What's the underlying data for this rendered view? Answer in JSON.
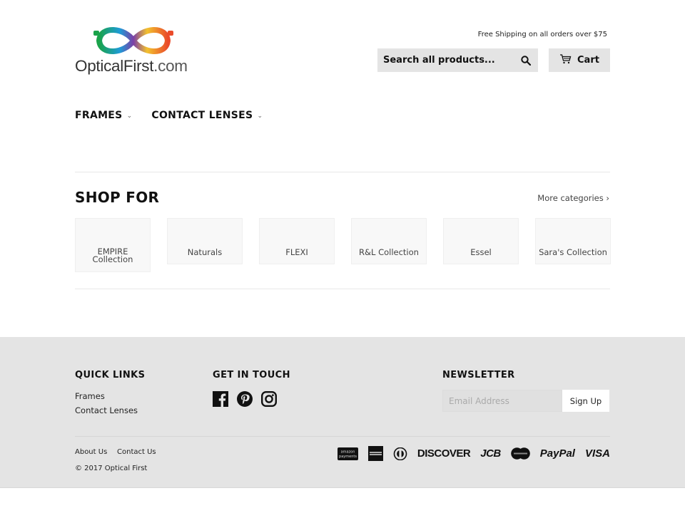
{
  "header": {
    "logo": {
      "name": "OpticalFirst",
      "suffix": ".com"
    },
    "promo": "Free Shipping on all orders over $75",
    "search": {
      "placeholder": "Search all products...",
      "value": ""
    },
    "cart_label": "Cart"
  },
  "nav": {
    "items": [
      {
        "label": "FRAMES",
        "icon": "chevron-down-icon"
      },
      {
        "label": "CONTACT LENSES",
        "icon": "chevron-down-icon"
      }
    ]
  },
  "shop": {
    "title": "SHOP FOR",
    "more_label": "More categories ›",
    "categories": [
      {
        "label": "EMPIRE Collection"
      },
      {
        "label": "Naturals"
      },
      {
        "label": "FLEXI"
      },
      {
        "label": "R&L Collection"
      },
      {
        "label": "Essel"
      },
      {
        "label": "Sara's Collection"
      }
    ]
  },
  "footer": {
    "quick_links": {
      "title": "QUICK LINKS",
      "links": [
        "Frames",
        "Contact Lenses"
      ]
    },
    "get_in_touch": {
      "title": "GET IN TOUCH",
      "icons": [
        "facebook-icon",
        "pinterest-icon",
        "instagram-icon"
      ]
    },
    "newsletter": {
      "title": "NEWSLETTER",
      "placeholder": "Email Address",
      "value": "",
      "button": "Sign Up"
    },
    "bottom_links": [
      "About Us",
      "Contact Us"
    ],
    "copyright": "© 2017 Optical First",
    "payments": {
      "amazon_top": "amazon",
      "amazon_bottom": "payments",
      "discover": "DISCOVER",
      "jcb": "JCB",
      "paypal": "PayPal",
      "visa": "VISA"
    }
  },
  "colors": {
    "footer_bg": "#e4e4e4",
    "button_bg": "#e4e4e4",
    "text": "#111111"
  }
}
